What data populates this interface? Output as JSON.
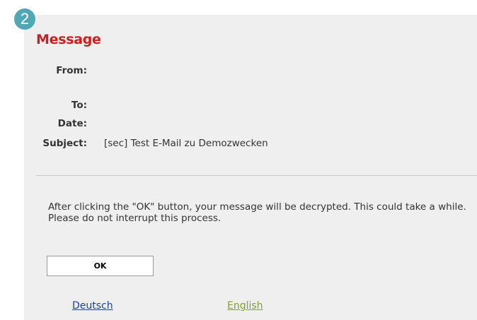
{
  "step": {
    "number": "2"
  },
  "message": {
    "title": "Message",
    "fields": {
      "from_label": "From:",
      "from_value": "",
      "to_label": "To:",
      "to_value": "",
      "date_label": "Date:",
      "date_value": "",
      "subject_label": "Subject:",
      "subject_value": "[sec] Test E-Mail zu Demozwecken"
    },
    "notice": "After clicking the \"OK\" button, your message will be decrypted. This could take a while. Please do not interrupt this process.",
    "ok_label": "OK"
  },
  "languages": {
    "deutsch": "Deutsch",
    "english": "English"
  },
  "colors": {
    "badge": "#52a7b4",
    "title": "#cc1f1f",
    "panel_background": "#efefef",
    "link_deutsch": "#1a3fb0",
    "link_english_active": "#7fa228"
  }
}
